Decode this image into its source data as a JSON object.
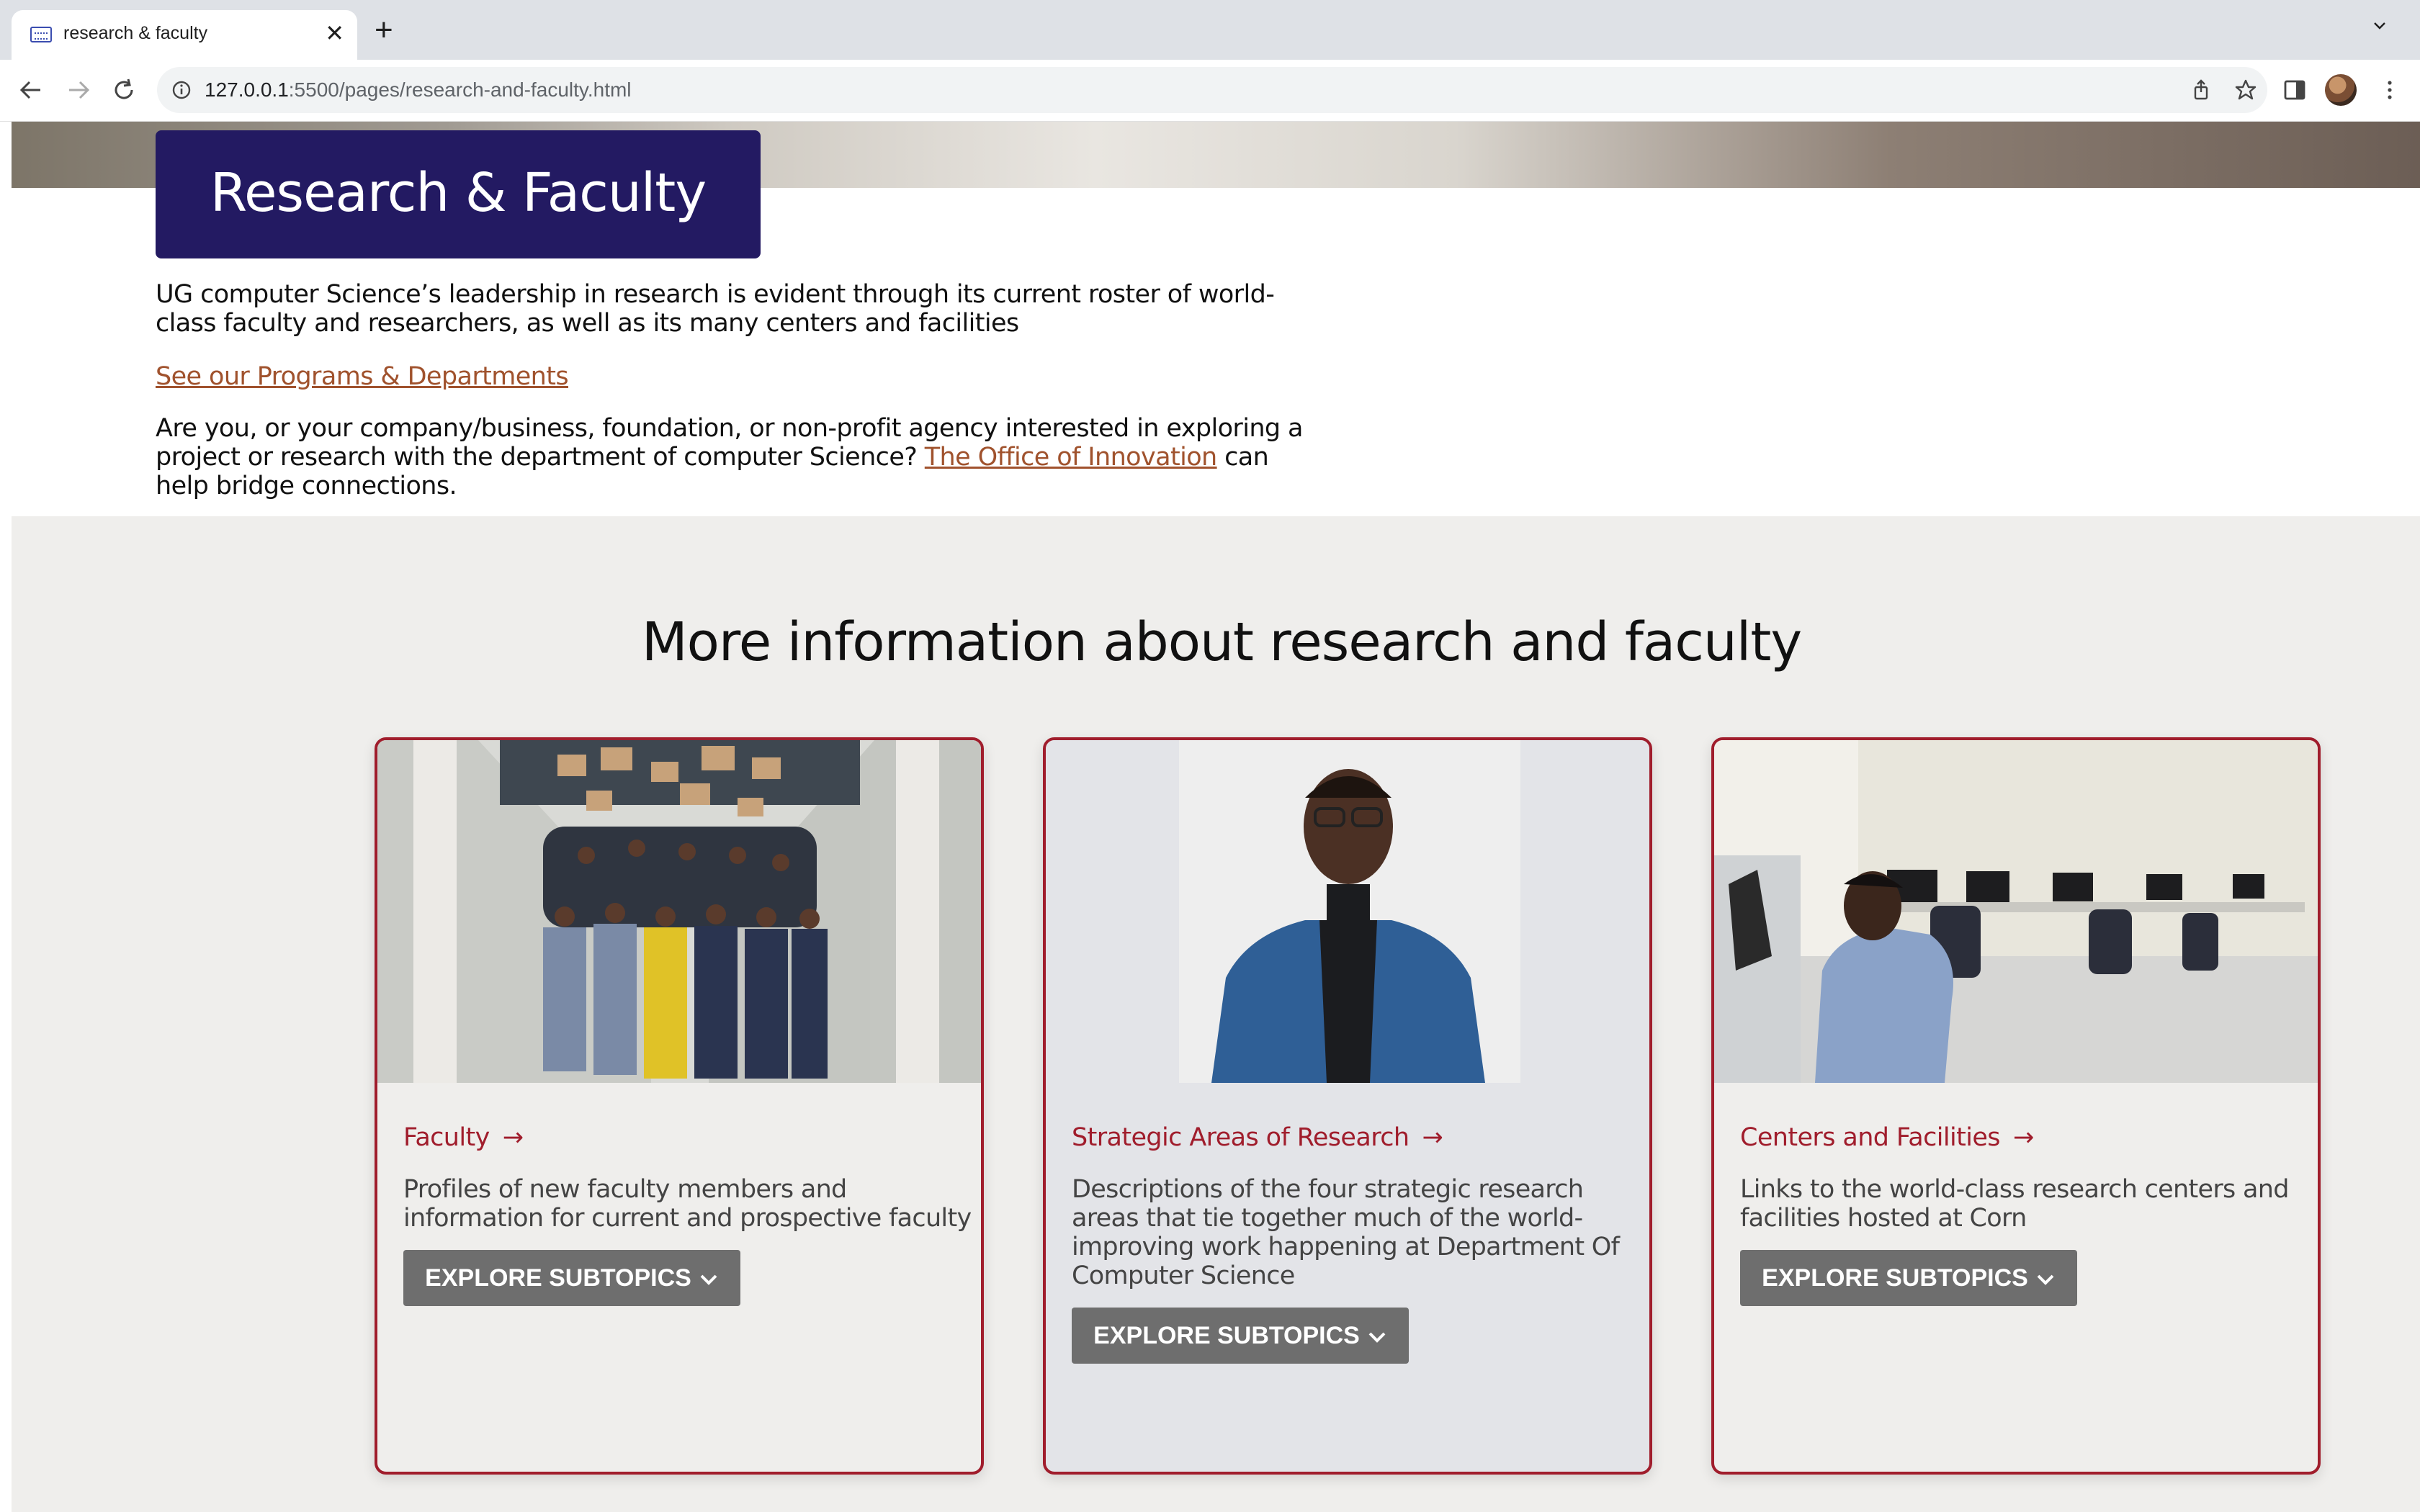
{
  "browser": {
    "tab_title": "research & faculty",
    "tab_close": "✕",
    "new_tab": "+",
    "url_host": "127.0.0.1",
    "url_path": ":5500/pages/research-and-faculty.html"
  },
  "page": {
    "title": "Research & Faculty",
    "intro_paragraph": "UG computer Science’s leadership in research is evident through its current roster of world-class faculty and researchers, as well as its many centers and facilities",
    "programs_link": "See our Programs & Departments",
    "innovation_text_before": "Are you, or your company/business, foundation, or non-profit agency interested in exploring a project or research with the department of computer Science?",
    "innovation_link": "The Office of Innovation",
    "innovation_text_after": "can help bridge connections.",
    "section_heading": "More information about research and faculty"
  },
  "cards": [
    {
      "link_label": "Faculty",
      "arrow": "→",
      "description": "Profiles of new faculty members and information for current and prospective faculty",
      "button_label": "EXPLORE SUBTOPICS"
    },
    {
      "link_label": "Strategic Areas of Research",
      "arrow": "→",
      "description": "Descriptions of the four strategic research areas that tie together much of the world-improving work happening at Department Of Computer Science",
      "button_label": "EXPLORE SUBTOPICS"
    },
    {
      "link_label": "Centers and Facilities",
      "arrow": "→",
      "description": "Links to the world-class research centers and facilities hosted at Corn",
      "button_label": "EXPLORE SUBTOPICS"
    }
  ],
  "colors": {
    "title_bg": "#231a62",
    "accent_red": "#a01d2c",
    "link_brown": "#a0522d",
    "button_gray": "#6e6e6e",
    "section_bg": "#efeeec"
  }
}
